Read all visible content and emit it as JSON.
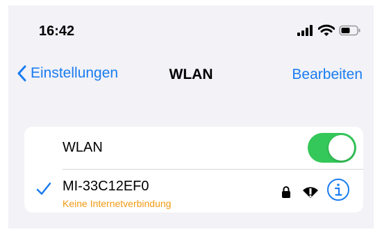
{
  "status_bar": {
    "time": "16:42",
    "icons": [
      "cellular-signal-icon",
      "wifi-icon",
      "battery-icon"
    ]
  },
  "nav": {
    "back_label": "Einstellungen",
    "title": "WLAN",
    "edit_label": "Bearbeiten"
  },
  "wlan_section": {
    "toggle_label": "WLAN",
    "toggle_on": true,
    "connected_network": {
      "name": "MI-33C12EF0",
      "status": "Keine Internetverbindung",
      "icons": [
        "checkmark-icon",
        "lock-icon",
        "wifi-no-internet-icon",
        "info-icon"
      ]
    }
  },
  "colors": {
    "accent": "#1a7cf0",
    "toggle_on": "#34c759",
    "warning": "#f39a12",
    "background": "#f2f2f7"
  }
}
